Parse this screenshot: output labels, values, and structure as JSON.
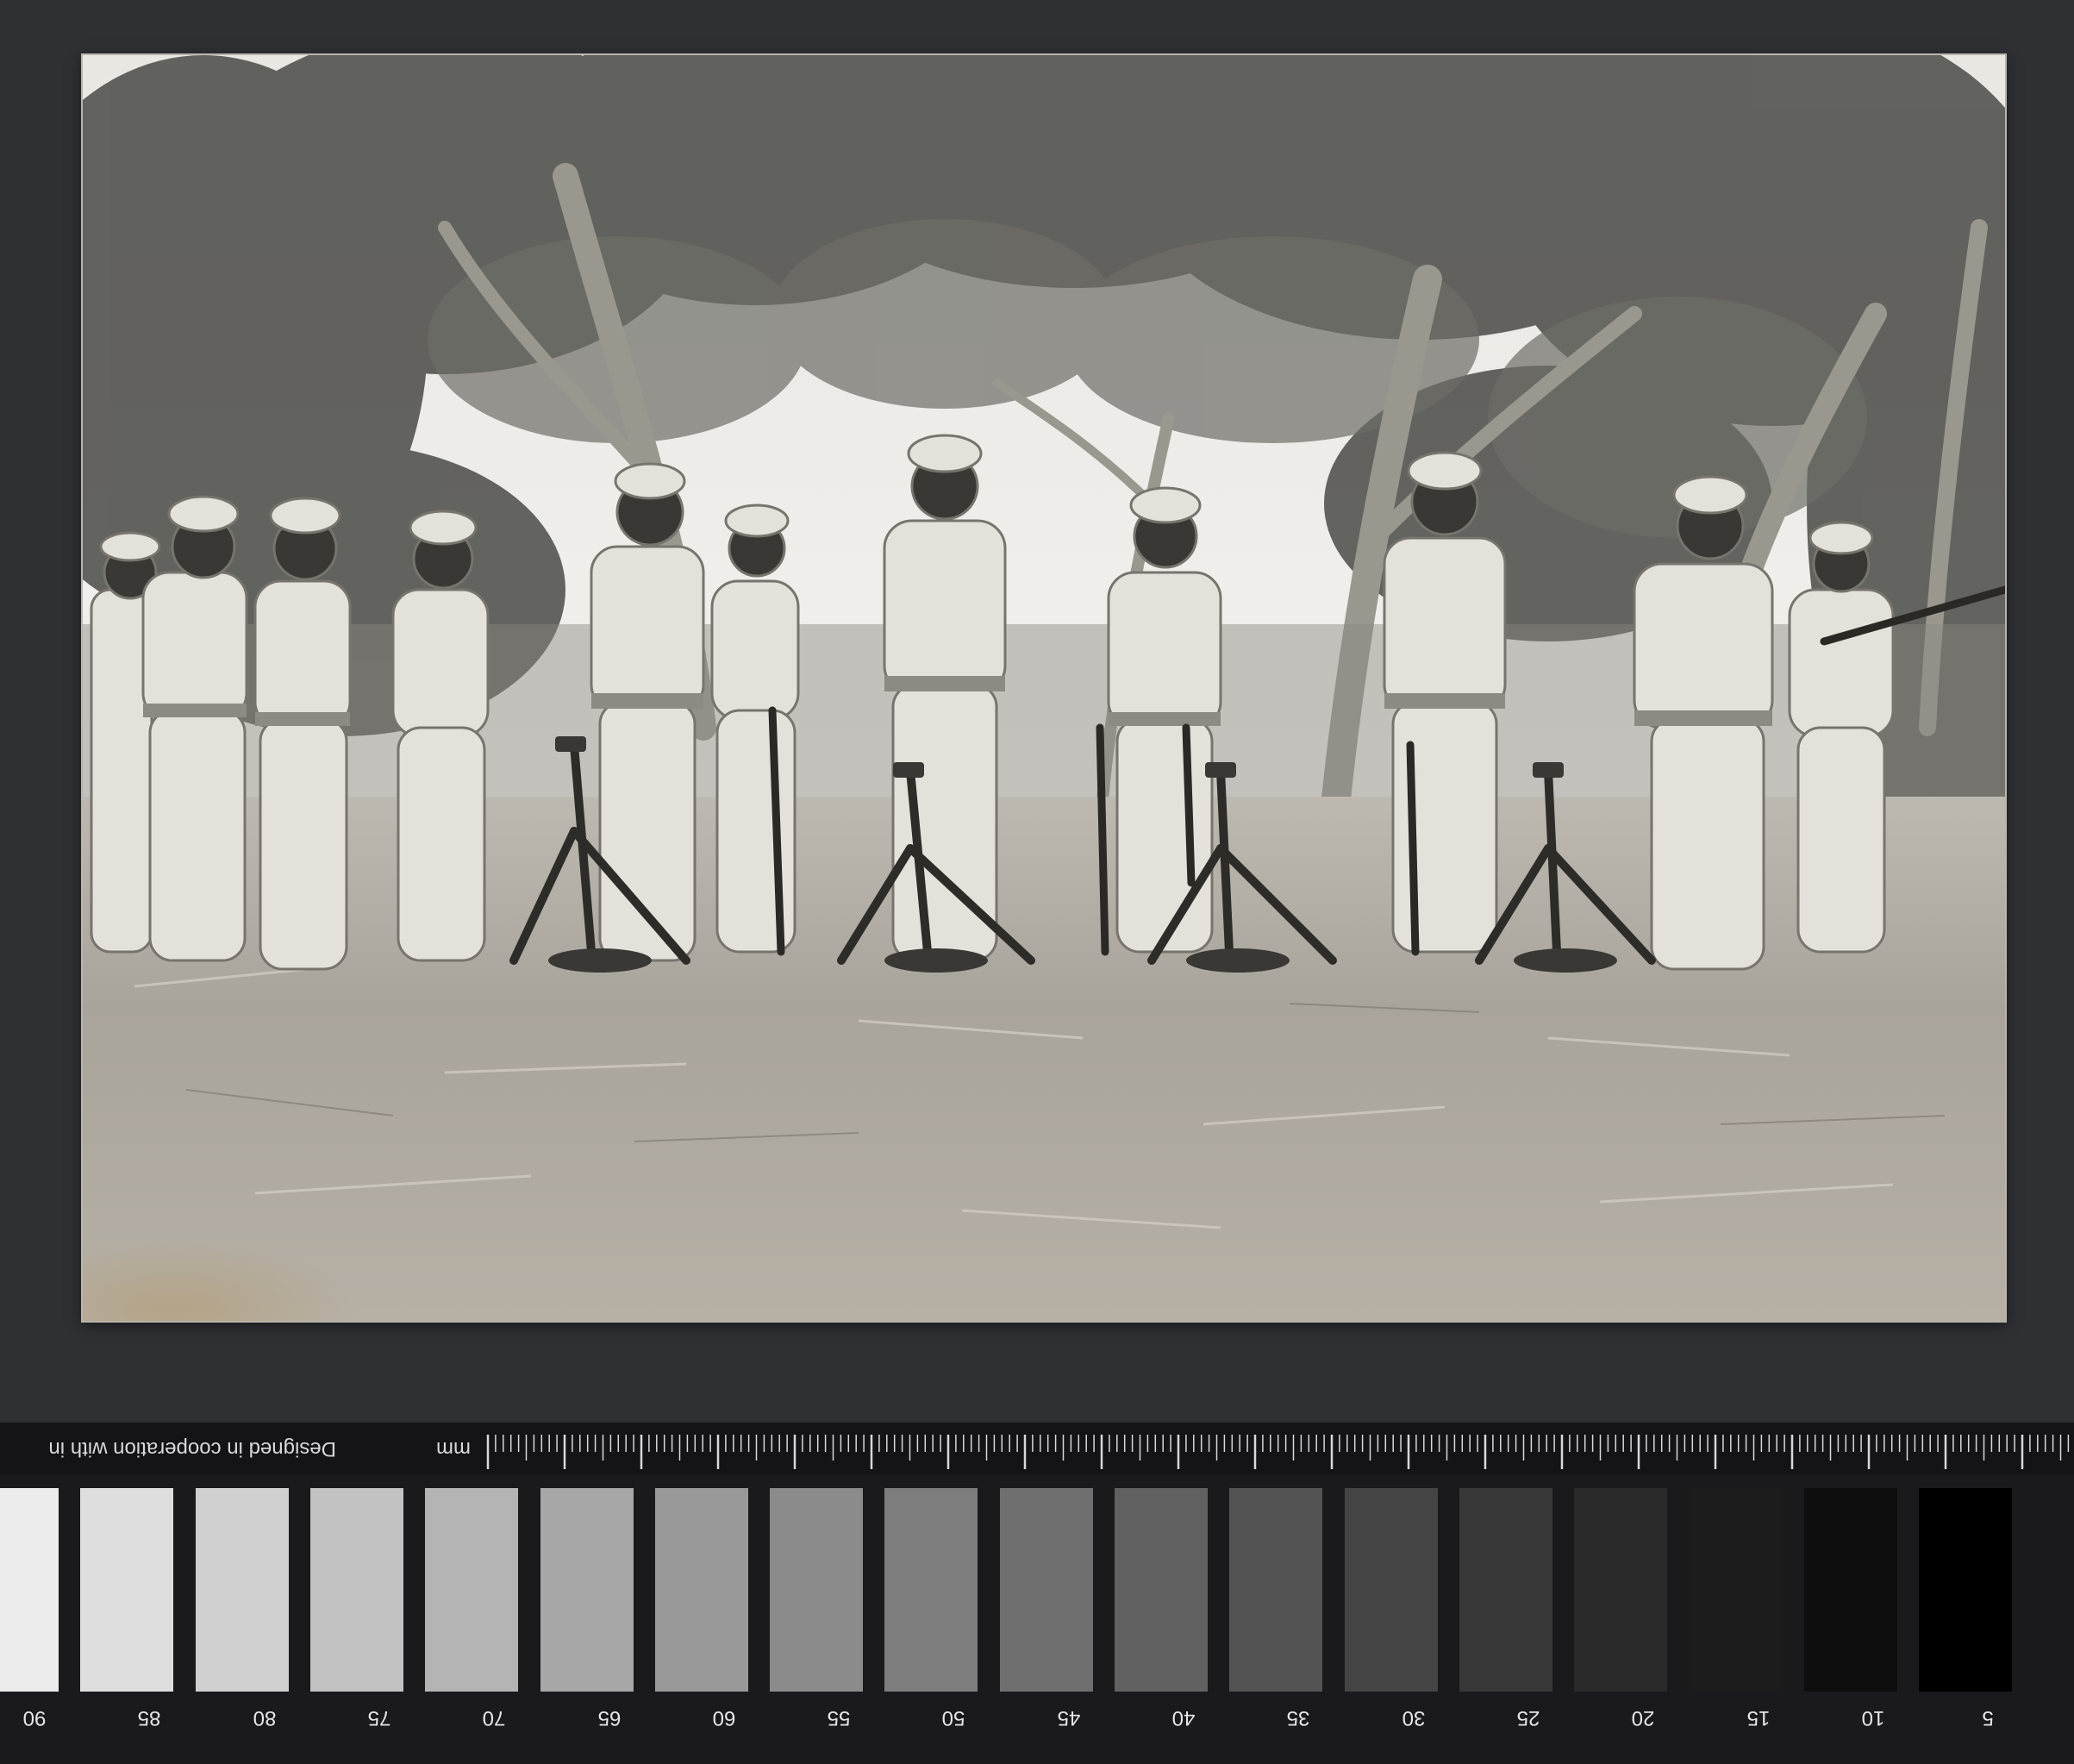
{
  "scale": {
    "note": "Designed in cooperation with in",
    "unit": "mm",
    "patch_labels": [
      "90",
      "85",
      "80",
      "75",
      "70",
      "65",
      "60",
      "55",
      "50",
      "45",
      "40",
      "35",
      "30",
      "25",
      "20",
      "15",
      "10",
      "5"
    ]
  },
  "colors": {
    "background": "#2f3034",
    "print": "#d9d6cf",
    "strip": "#1a1a1c"
  }
}
